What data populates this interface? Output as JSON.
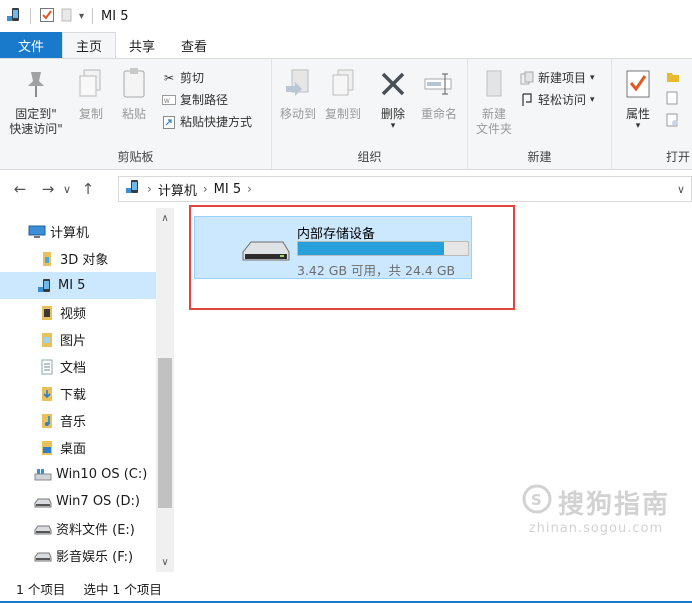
{
  "window": {
    "title": "MI 5"
  },
  "ribbon_tabs": [
    "文件",
    "主页",
    "共享",
    "查看"
  ],
  "ribbon": {
    "clipboard": {
      "pin_label_line1": "固定到\"",
      "pin_label_line2": "快速访问\"",
      "copy_label": "复制",
      "paste_label": "粘贴",
      "cut_label": "剪切",
      "copy_path_label": "复制路径",
      "paste_shortcut_label": "粘贴快捷方式",
      "group_label": "剪贴板"
    },
    "organize": {
      "move_to_label": "移动到",
      "copy_to_label": "复制到",
      "delete_label": "删除",
      "rename_label": "重命名",
      "group_label": "组织"
    },
    "new": {
      "new_folder_line1": "新建",
      "new_folder_line2": "文件夹",
      "new_item_label": "新建项目",
      "easy_access_label": "轻松访问",
      "group_label": "新建"
    },
    "open": {
      "properties_label": "属性",
      "group_label": "打开"
    }
  },
  "address": {
    "segments": [
      "计算机",
      "MI 5"
    ]
  },
  "sidebar": {
    "items": [
      {
        "label": "计算机",
        "icon": "computer-icon"
      },
      {
        "label": "3D 对象",
        "icon": "3d-objects-icon"
      },
      {
        "label": "MI 5",
        "icon": "phone-icon"
      },
      {
        "label": "视频",
        "icon": "videos-icon"
      },
      {
        "label": "图片",
        "icon": "pictures-icon"
      },
      {
        "label": "文档",
        "icon": "documents-icon"
      },
      {
        "label": "下载",
        "icon": "downloads-icon"
      },
      {
        "label": "音乐",
        "icon": "music-icon"
      },
      {
        "label": "桌面",
        "icon": "desktop-icon"
      },
      {
        "label": "Win10 OS (C:)",
        "icon": "windows-drive-icon"
      },
      {
        "label": "Win7 OS (D:)",
        "icon": "drive-icon"
      },
      {
        "label": "资料文件 (E:)",
        "icon": "drive-icon"
      },
      {
        "label": "影音娱乐 (F:)",
        "icon": "drive-icon"
      }
    ],
    "selected_index": 2
  },
  "content": {
    "drive_name": "内部存储设备",
    "drive_info": "3.42 GB 可用，共 24.4 GB",
    "used_fraction": 0.86
  },
  "statusbar": {
    "item_count": "1 个项目",
    "selected_count": "选中 1 个项目"
  },
  "watermark": {
    "main": "搜狗指南",
    "sub": "zhinan.sogou.com"
  },
  "colors": {
    "accent": "#1979ca",
    "selection": "#cce8ff",
    "progress": "#26a0da",
    "highlight": "#e3443b"
  }
}
